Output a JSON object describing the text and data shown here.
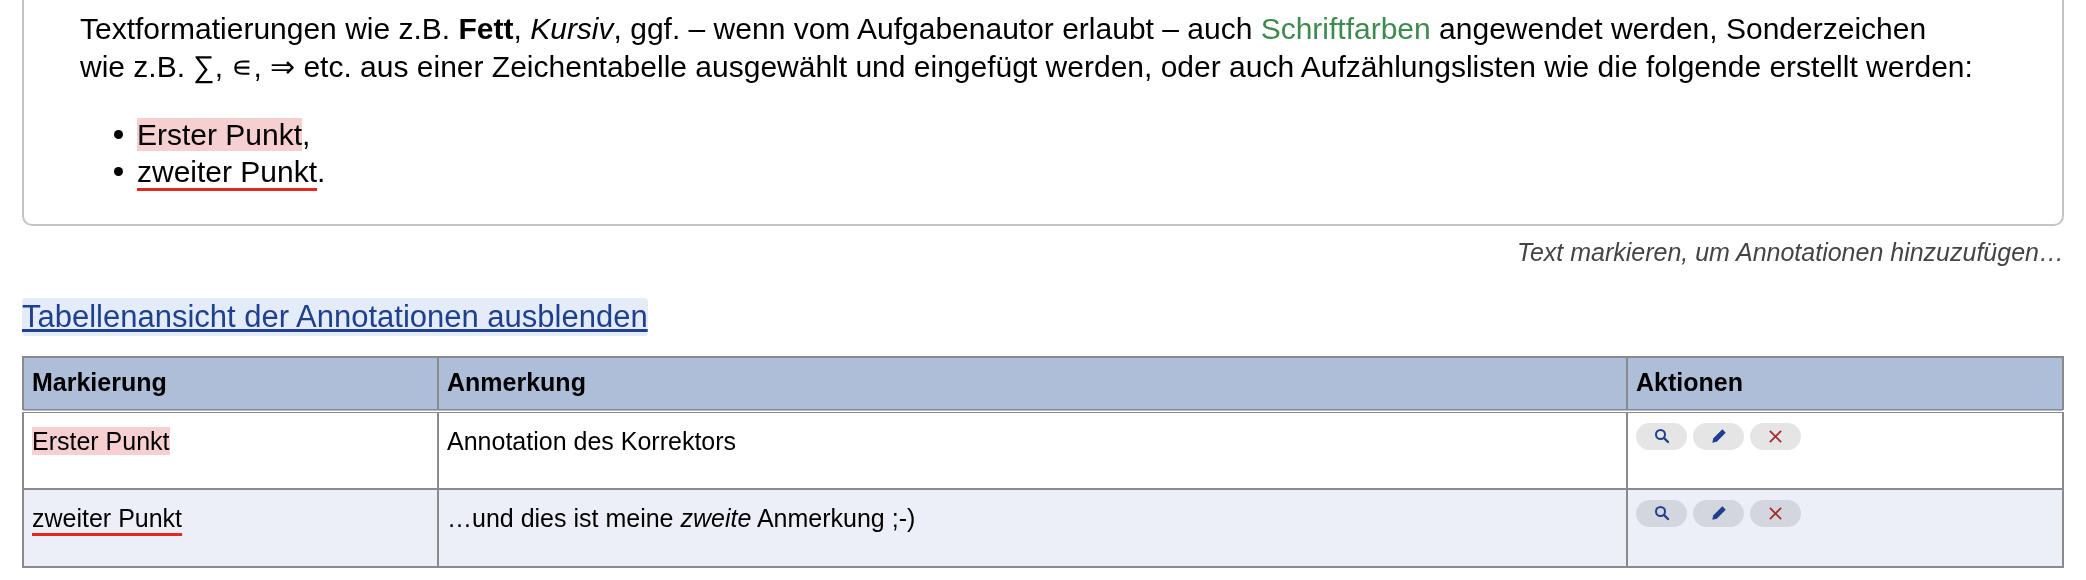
{
  "editor": {
    "lines": [
      [
        {
          "text": "Textformatierungen wie z.B. **Fett**, *Kursiv*, ggf. – wenn vom Aufgabenautor erlaubt – auch "
        },
        {
          "text": "Schriftfarben",
          "color": "#3d8b4f"
        },
        {
          "text": " angewendet werden, Sonderzeichen"
        }
      ],
      [
        {
          "text": "wie z.B. ∑, ∊, ⇒ etc. aus einer Zeichentabelle ausgewählt und eingefügt werden, oder auch Aufzählungslisten wie die folgende erstellt werden:"
        }
      ]
    ],
    "list": [
      {
        "text": "Erster Punkt",
        "kind": "highlight",
        "after": ","
      },
      {
        "text": "zweiter Punkt",
        "kind": "underline",
        "after": "."
      }
    ]
  },
  "hint": "Text markieren, um Annotationen hinzuzufügen…",
  "toggle_link": "Tabellenansicht der Annotationen ausblenden",
  "table": {
    "columns": [
      "Markierung",
      "Anmerkung",
      "Aktionen"
    ],
    "rows": [
      {
        "marking": "Erster Punkt",
        "kind": "highlight",
        "note": "Annotation des Korrektors"
      },
      {
        "marking": "zweiter Punkt",
        "kind": "underline",
        "note": "…und dies ist meine *zweite* Anmerkung ;-)"
      }
    ]
  }
}
